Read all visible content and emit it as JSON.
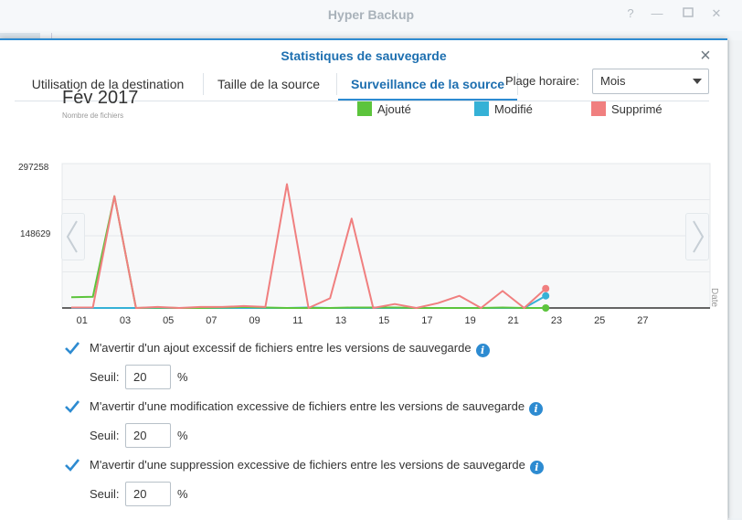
{
  "app": {
    "title": "Hyper Backup"
  },
  "dialog": {
    "title": "Statistiques de sauvegarde"
  },
  "tabs": [
    {
      "label": "Utilisation de la destination"
    },
    {
      "label": "Taille de la source"
    },
    {
      "label": "Surveillance de la source",
      "active": true
    }
  ],
  "range": {
    "label": "Plage horaire:",
    "value": "Mois"
  },
  "chart_header": {
    "period": "Fév 2017",
    "subtitle": "Nombre de fichiers"
  },
  "colors": {
    "accent": "#2d8bd1",
    "added": "#5cc43c",
    "modified": "#35b1d6",
    "deleted": "#f07f7f"
  },
  "chart_data": {
    "type": "line",
    "ylim": [
      0,
      297258
    ],
    "ytick_labels": [
      "297258",
      "148629"
    ],
    "xlabel": "Date",
    "xtick_labels": [
      "01",
      "03",
      "05",
      "07",
      "09",
      "11",
      "13",
      "15",
      "17",
      "19",
      "21",
      "23",
      "25",
      "27"
    ],
    "x": [
      0,
      1,
      2,
      3,
      4,
      5,
      6,
      7,
      8,
      9,
      10,
      11,
      12,
      13,
      14,
      15,
      16,
      17,
      18,
      19,
      20,
      21,
      22
    ],
    "series": [
      {
        "name": "Ajouté",
        "values": [
          22000,
          23000,
          230000,
          0,
          1000,
          0,
          0,
          1000,
          2000,
          1000,
          0,
          0,
          0,
          1000,
          1000,
          1000,
          0,
          0,
          0,
          0,
          1000,
          0,
          0
        ]
      },
      {
        "name": "Modifié",
        "values": [
          0,
          0,
          0,
          0,
          0,
          0,
          0,
          0,
          0,
          0,
          0,
          1000,
          0,
          0,
          0,
          0,
          0,
          0,
          0,
          0,
          0,
          0,
          25000
        ]
      },
      {
        "name": "Supprimé",
        "values": [
          1000,
          1000,
          230000,
          0,
          2000,
          0,
          2000,
          2000,
          4000,
          2000,
          255000,
          0,
          20000,
          184000,
          0,
          8000,
          0,
          10000,
          25000,
          0,
          35000,
          0,
          40000
        ]
      }
    ]
  },
  "alerts": [
    {
      "checked": true,
      "label": "M'avertir d'un ajout excessif de fichiers entre les versions de sauvegarde",
      "seuil_label": "Seuil:",
      "value": "20",
      "unit": "%"
    },
    {
      "checked": true,
      "label": "M'avertir d'une modification excessive de fichiers entre les versions de sauvegarde",
      "seuil_label": "Seuil:",
      "value": "20",
      "unit": "%"
    },
    {
      "checked": true,
      "label": "M'avertir d'une suppression excessive de fichiers entre les versions de sauvegarde",
      "seuil_label": "Seuil:",
      "value": "20",
      "unit": "%"
    }
  ]
}
